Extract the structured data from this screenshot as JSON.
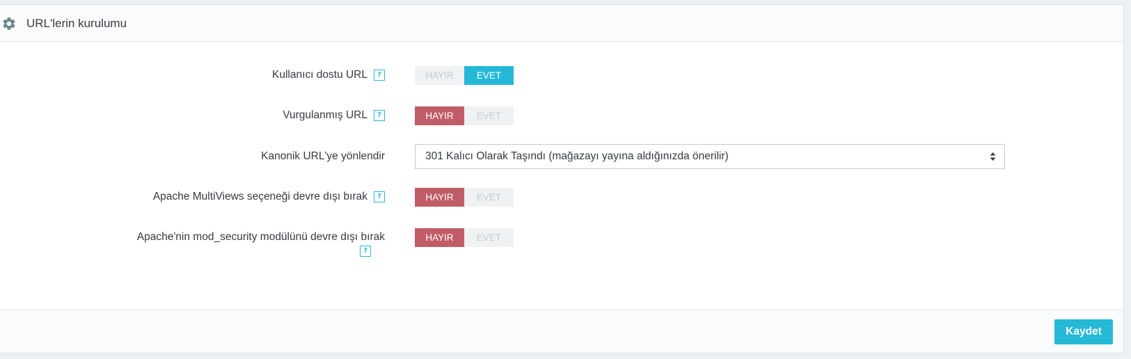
{
  "panel": {
    "title": "URL'lerin kurulumu",
    "icon": "gear-icon"
  },
  "rows": [
    {
      "label": "Kullanıcı dostu URL",
      "has_help": true,
      "type": "toggle",
      "no_label": "HAYIR",
      "yes_label": "EVET",
      "value": "EVET"
    },
    {
      "label": "Vurgulanmış URL",
      "has_help": true,
      "type": "toggle",
      "no_label": "HAYIR",
      "yes_label": "EVET",
      "value": "HAYIR"
    },
    {
      "label": "Kanonik URL'ye yönlendir",
      "has_help": false,
      "type": "select",
      "selected": "301 Kalıcı Olarak Taşındı (mağazayı yayına aldığınızda önerilir)"
    },
    {
      "label": "Apache MultiViews seçeneği devre dışı bırak",
      "has_help": true,
      "type": "toggle",
      "no_label": "HAYIR",
      "yes_label": "EVET",
      "value": "HAYIR"
    },
    {
      "label": "Apache'nin mod_security modülünü devre dışı bırak",
      "has_help": true,
      "type": "toggle",
      "no_label": "HAYIR",
      "yes_label": "EVET",
      "value": "HAYIR"
    }
  ],
  "help_glyph": "?",
  "footer": {
    "save_label": "Kaydet"
  },
  "colors": {
    "accent": "#25b9d7",
    "danger": "#c05c67",
    "text": "#363a41"
  }
}
